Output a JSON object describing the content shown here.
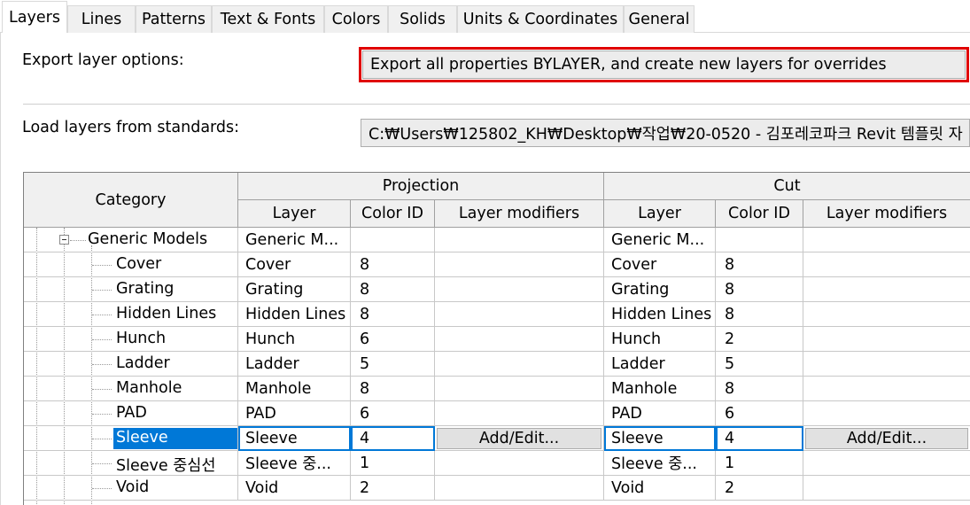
{
  "tabs": [
    {
      "label": "Layers",
      "active": true
    },
    {
      "label": "Lines"
    },
    {
      "label": "Patterns"
    },
    {
      "label": "Text & Fonts"
    },
    {
      "label": "Colors"
    },
    {
      "label": "Solids"
    },
    {
      "label": "Units & Coordinates"
    },
    {
      "label": "General"
    }
  ],
  "export_layer_options": {
    "label": "Export layer options:",
    "value": "Export all properties BYLAYER, and create new layers for overrides",
    "highlight_color": "#e00000"
  },
  "load_layers": {
    "label": "Load layers from standards:",
    "value": "C:₩Users₩125802_KH₩Desktop₩작업₩20-0520 - 김포레코파크 Revit 템플릿 자 ↓"
  },
  "grid": {
    "headers": {
      "category": "Category",
      "projection": "Projection",
      "cut": "Cut",
      "layer": "Layer",
      "color_id": "Color ID",
      "layer_modifiers": "Layer modifiers"
    },
    "rows": [
      {
        "category": "Generic Models",
        "proj_layer": "Generic M...",
        "proj_color": "",
        "proj_mod": "",
        "cut_layer": "Generic M...",
        "cut_color": "",
        "cut_mod": "",
        "parent": true
      },
      {
        "category": "Cover",
        "proj_layer": "Cover",
        "proj_color": "8",
        "proj_mod": "",
        "cut_layer": "Cover",
        "cut_color": "8",
        "cut_mod": ""
      },
      {
        "category": "Grating",
        "proj_layer": "Grating",
        "proj_color": "8",
        "proj_mod": "",
        "cut_layer": "Grating",
        "cut_color": "8",
        "cut_mod": ""
      },
      {
        "category": "Hidden Lines",
        "proj_layer": "Hidden Lines",
        "proj_color": "8",
        "proj_mod": "",
        "cut_layer": "Hidden Lines",
        "cut_color": "8",
        "cut_mod": ""
      },
      {
        "category": "Hunch",
        "proj_layer": "Hunch",
        "proj_color": "6",
        "proj_mod": "",
        "cut_layer": "Hunch",
        "cut_color": "2",
        "cut_mod": ""
      },
      {
        "category": "Ladder",
        "proj_layer": "Ladder",
        "proj_color": "5",
        "proj_mod": "",
        "cut_layer": "Ladder",
        "cut_color": "5",
        "cut_mod": ""
      },
      {
        "category": "Manhole",
        "proj_layer": "Manhole",
        "proj_color": "8",
        "proj_mod": "",
        "cut_layer": "Manhole",
        "cut_color": "8",
        "cut_mod": ""
      },
      {
        "category": "PAD",
        "proj_layer": "PAD",
        "proj_color": "6",
        "proj_mod": "",
        "cut_layer": "PAD",
        "cut_color": "6",
        "cut_mod": ""
      },
      {
        "category": "Sleeve",
        "proj_layer": "Sleeve",
        "proj_color": "4",
        "proj_mod": "Add/Edit...",
        "cut_layer": "Sleeve",
        "cut_color": "4",
        "cut_mod": "Add/Edit...",
        "selected": true
      },
      {
        "category": "Sleeve 중심선",
        "proj_layer": "Sleeve 중...",
        "proj_color": "1",
        "proj_mod": "",
        "cut_layer": "Sleeve 중...",
        "cut_color": "1",
        "cut_mod": ""
      },
      {
        "category": "Void",
        "proj_layer": "Void",
        "proj_color": "2",
        "proj_mod": "",
        "cut_layer": "Void",
        "cut_color": "2",
        "cut_mod": ""
      }
    ],
    "selection_color": "#0078d7"
  }
}
